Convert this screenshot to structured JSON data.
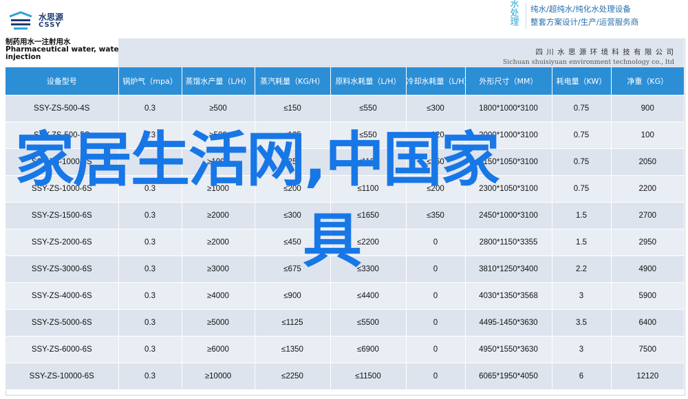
{
  "brand": {
    "name_cn": "水思源",
    "name_en": "CSSY"
  },
  "slogan": {
    "vertical": [
      "水",
      "处",
      "理"
    ],
    "line1": "纯水/超纯水/纯化水处理设备",
    "line2": "整套方案设计/生产/运营服务商"
  },
  "header": {
    "title_line1": "制药用水一注射用水",
    "title_line2": "Pharmaceutical water, water for",
    "title_line3": "injection",
    "company_cn": "四 川 水 思 源 环 境 科 技 有 限 公 司",
    "company_en": "Sichuan shuisiyuan environment technology co., ltd"
  },
  "table": {
    "columns": [
      "设备型号",
      "锅炉气（mpa）",
      "蒸馏水产量（L/H）",
      "蒸汽耗量（KG/H）",
      "原料水耗量（L/H）",
      "冷却水耗量（L/H）",
      "外形尺寸（MM）",
      "耗电量（KW）",
      "净重（KG）"
    ],
    "rows": [
      [
        "SSY-ZS-500-4S",
        "0.3",
        "≥500",
        "≤150",
        "≤550",
        "≤300",
        "1800*1000*3100",
        "0.75",
        "900"
      ],
      [
        "SSY-ZS-500-5S",
        "0.3",
        "≥500",
        "≤125",
        "≤550",
        "≤120",
        "2000*1000*3100",
        "0.75",
        "100"
      ],
      [
        "SSY-ZS-1000-5S",
        "0.3",
        "≥1000",
        "≤250",
        "≤1100",
        "≤250",
        "2150*1050*3100",
        "0.75",
        "2050"
      ],
      [
        "SSY-ZS-1000-6S",
        "0.3",
        "≥1000",
        "≤200",
        "≤1100",
        "≤200",
        "2300*1050*3100",
        "0.75",
        "2200"
      ],
      [
        "SSY-ZS-1500-6S",
        "0.3",
        "≥2000",
        "≤300",
        "≤1650",
        "≤350",
        "2450*1000*3100",
        "1.5",
        "2700"
      ],
      [
        "SSY-ZS-2000-6S",
        "0.3",
        "≥2000",
        "≤450",
        "≤2200",
        "0",
        "2800*1150*3355",
        "1.5",
        "2950"
      ],
      [
        "SSY-ZS-3000-6S",
        "0.3",
        "≥3000",
        "≤675",
        "≤3300",
        "0",
        "3810*1250*3400",
        "2.2",
        "4900"
      ],
      [
        "SSY-ZS-4000-6S",
        "0.3",
        "≥4000",
        "≤900",
        "≤4400",
        "0",
        "4030*1350*3568",
        "3",
        "5900"
      ],
      [
        "SSY-ZS-5000-6S",
        "0.3",
        "≥5000",
        "≤1125",
        "≤5500",
        "0",
        "4495-1450*3630",
        "3.5",
        "6400"
      ],
      [
        "SSY-ZS-6000-6S",
        "0.3",
        "≥6000",
        "≤1350",
        "≤6900",
        "0",
        "4950*1550*3630",
        "3",
        "7500"
      ],
      [
        "SSY-ZS-10000-6S",
        "0.3",
        "≥10000",
        "≤2250",
        "≤11500",
        "0",
        "6065*1950*4050",
        "6",
        "12120"
      ]
    ]
  },
  "overlay": {
    "line1": "家居生活网,中国家",
    "line2": "具"
  },
  "colors": {
    "header_blue": "#2c8fd6",
    "overlay_blue": "#1877e6",
    "brand_navy": "#1f3b73"
  }
}
